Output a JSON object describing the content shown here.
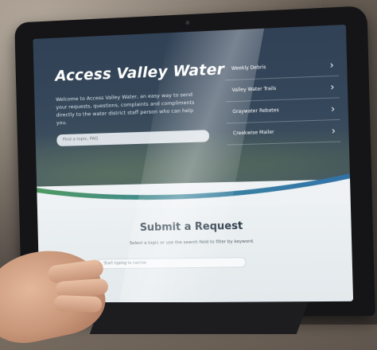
{
  "site": {
    "title": "Access Valley Water",
    "intro": "Welcome to Access Valley Water, an easy way to send your requests, questions, complaints and compliments directly to the water district staff person who can help you.",
    "search_placeholder": "Find a topic, FAQ"
  },
  "nav": {
    "items": [
      {
        "label": "Weekly Debris"
      },
      {
        "label": "Valley Water Trails"
      },
      {
        "label": "Graywater Rebates"
      },
      {
        "label": "Creekwise Mailer"
      }
    ]
  },
  "request": {
    "title": "Submit a Request",
    "subtitle": "Select a topic or use the search field to filter by keyword.",
    "search_placeholder": "Start typing to narrow"
  },
  "colors": {
    "hero": "#34465c",
    "accent_wave_green": "#4f9b5a",
    "accent_wave_blue": "#2f6fa8"
  }
}
